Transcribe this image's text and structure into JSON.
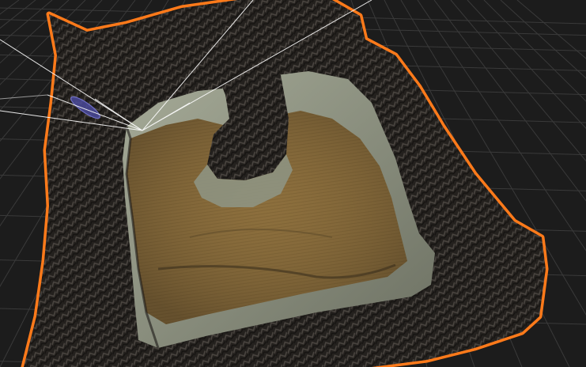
{
  "viewport": {
    "background": "#1c1c1c",
    "grid_color": "#3a3a3a",
    "selection_outline_color": "#ff7a1a"
  },
  "scene": {
    "objects": [
      {
        "name": "terrain",
        "selected": true
      },
      {
        "name": "camera-gizmo",
        "selected": false
      },
      {
        "name": "light-gizmo",
        "selected": false
      }
    ],
    "terrain_layers": [
      {
        "name": "rock-cliff",
        "color": "#2e2a26"
      },
      {
        "name": "sand-basin",
        "color": "#8a6e3e"
      },
      {
        "name": "pale-grass",
        "color": "#8b8f7e"
      }
    ]
  },
  "icons": {
    "camera_gizmo": "camera-frustum-icon",
    "light_gizmo": "light-gizmo-icon"
  }
}
